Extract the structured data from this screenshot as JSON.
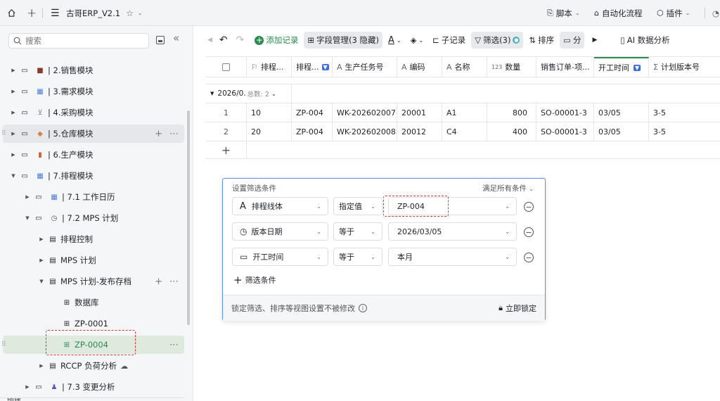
{
  "topbar": {
    "title": "古哥ERP_V2.1",
    "script": "脚本",
    "automation": "自动化流程",
    "plugin": "插件"
  },
  "sidebar": {
    "search_placeholder": "搜索",
    "items": [
      {
        "label": "| 2.销售模块",
        "icon": "briefcase-icon"
      },
      {
        "label": "| 3.需求模块",
        "icon": "calendar-icon"
      },
      {
        "label": "| 4.采购模块",
        "icon": "cart-icon"
      },
      {
        "label": "| 5.仓库模块",
        "icon": "box-icon"
      },
      {
        "label": "| 6.生产模块",
        "icon": "book-icon"
      },
      {
        "label": "| 7.排程模块",
        "icon": "calendar-icon"
      },
      {
        "label": "| 7.1 工作日历",
        "icon": "calendar-icon"
      },
      {
        "label": "| 7.2 MPS 计划",
        "icon": "clock-icon"
      },
      {
        "label": "排程控制",
        "icon": "doc-icon"
      },
      {
        "label": "MPS 计划",
        "icon": "doc-icon"
      },
      {
        "label": "MPS 计划-发布存档",
        "icon": "doc-icon"
      },
      {
        "label": "数据库",
        "icon": "table-icon"
      },
      {
        "label": "ZP-0001",
        "icon": "table-icon"
      },
      {
        "label": "ZP-0004",
        "icon": "table-icon"
      },
      {
        "label": "RCCP 负荷分析",
        "icon": "doc-icon"
      },
      {
        "label": "| 7.3 变更分析",
        "icon": "bowling-icon"
      }
    ],
    "bottom_label": "创建"
  },
  "toolbar": {
    "add": "添加记录",
    "fields": "字段管理(3 隐藏)",
    "subrecord": "子记录",
    "filter": "筛选(3)",
    "sort": "排序",
    "group": "分",
    "ai": "AI 数据分析"
  },
  "table": {
    "headers": [
      "排程...",
      "排程...",
      "生产任务号",
      "编码",
      "名称",
      "数量",
      "销售订单-项...",
      "开工时间",
      "计划版本号"
    ],
    "group_label": "2026/0.",
    "group_count": "总数: 2",
    "rows": [
      {
        "idx": "1",
        "c": [
          "10",
          "ZP-004",
          "WK-202602007",
          "20001",
          "A1",
          "800",
          "SO-00001-3",
          "03/05",
          "3-5"
        ]
      },
      {
        "idx": "2",
        "c": [
          "20",
          "ZP-004",
          "WK-202602008",
          "20012",
          "C4",
          "400",
          "SO-00001-3",
          "03/05",
          "3-5"
        ]
      }
    ]
  },
  "filter": {
    "title": "设置筛选条件",
    "match": "满足所有条件",
    "conditions": [
      {
        "field": "排程线体",
        "op": "指定值",
        "value": "ZP-004"
      },
      {
        "field": "版本日期",
        "op": "等于",
        "value": "2026/03/05"
      },
      {
        "field": "开工时间",
        "op": "等于",
        "value": "本月"
      }
    ],
    "add": "筛选条件",
    "lock_note": "锁定筛选、排序等视图设置不被修改",
    "lock_btn": "立即锁定"
  },
  "colors": {
    "accent": "#2b8a4e",
    "highlight": "#e03030",
    "panel_border": "#5b8def"
  }
}
